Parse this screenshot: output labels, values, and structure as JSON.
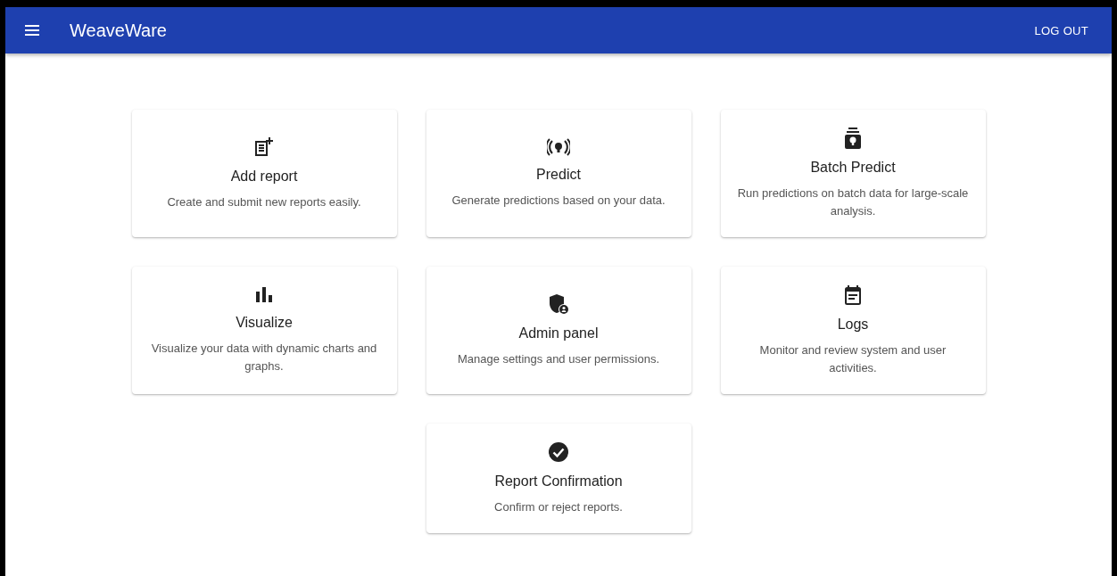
{
  "app_bar": {
    "title": "WeaveWare",
    "action": "LOG OUT"
  },
  "cards": [
    {
      "title": "Add report",
      "description": "Create and submit new reports easily."
    },
    {
      "title": "Predict",
      "description": "Generate predictions based on your data."
    },
    {
      "title": "Batch Predict",
      "description": "Run predictions on batch data for large-scale analysis."
    },
    {
      "title": "Visualize",
      "description": "Visualize your data with dynamic charts and graphs."
    },
    {
      "title": "Admin panel",
      "description": "Manage settings and user permissions."
    },
    {
      "title": "Logs",
      "description": "Monitor and review system and user activities."
    },
    {
      "title": "Report Confirmation",
      "description": "Confirm or reject reports."
    }
  ]
}
